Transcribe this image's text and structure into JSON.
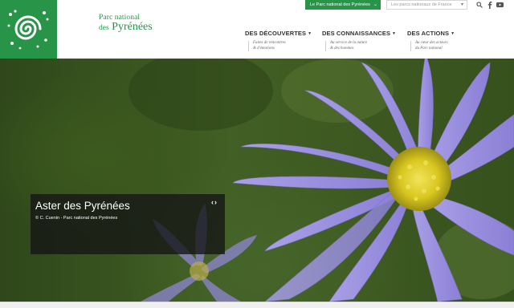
{
  "brand": {
    "line1": "Parc national",
    "line2_prefix": "des",
    "line2_main": "Pyrénées",
    "green": "#279448"
  },
  "topbar": {
    "park_select": "Le Parc national des Pyrénées",
    "parks_select": "Les parcs nationaux de France",
    "icons": [
      "search-icon",
      "facebook-icon",
      "youtube-icon"
    ]
  },
  "nav": {
    "items": [
      {
        "label": "DES DÉCOUVERTES",
        "sub1": "Faites de rencontres",
        "sub2": "& d'émotions"
      },
      {
        "label": "DES CONNAISSANCES",
        "sub1": "Au service de la nature",
        "sub2": "& des hommes"
      },
      {
        "label": "DES ACTIONS",
        "sub1": "Au cœur des acteurs",
        "sub2": "du Parc national"
      }
    ]
  },
  "hero": {
    "title": "Aster des Pyrénées",
    "credit": "© C. Cuenin - Parc national des Pyrénées",
    "nav_arrows": "‹›"
  }
}
